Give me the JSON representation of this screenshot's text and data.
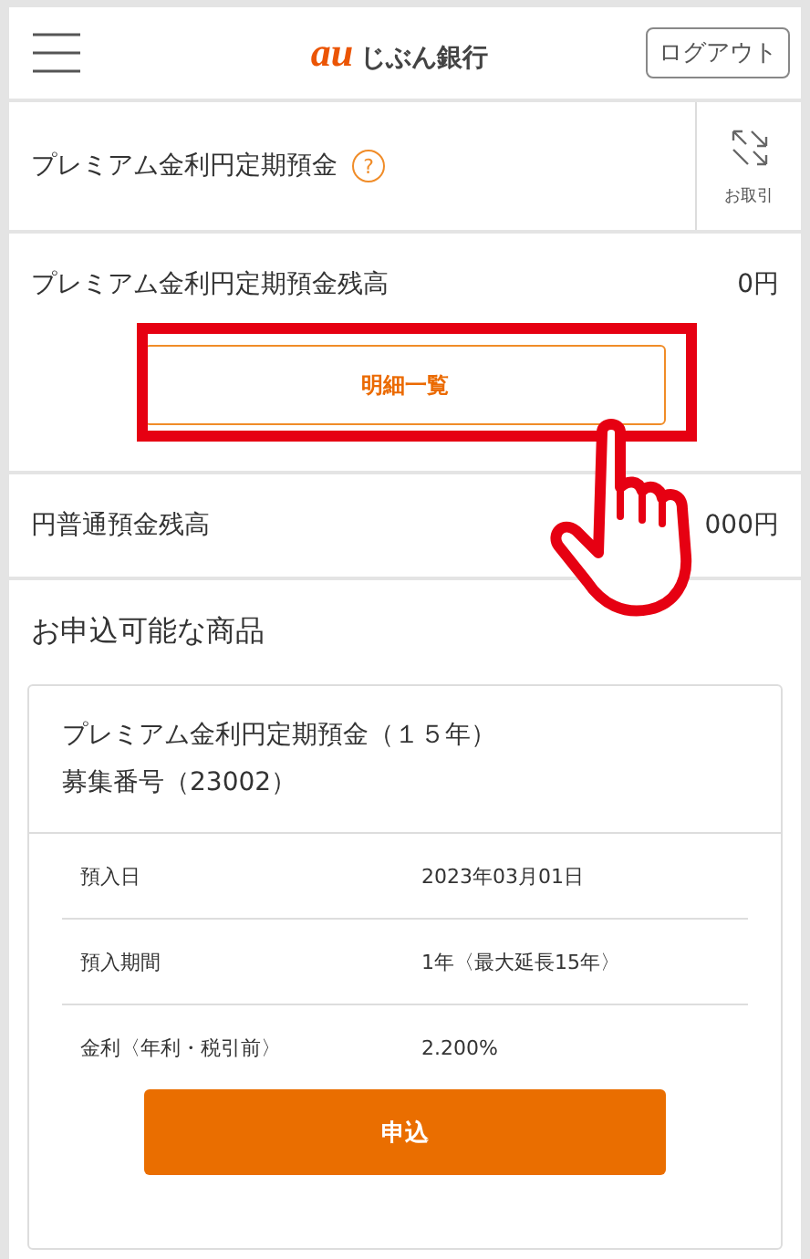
{
  "header": {
    "logo_mark": "au",
    "logo_name": "じぶん銀行",
    "logout": "ログアウト"
  },
  "product_bar": {
    "title": "プレミアム金利円定期預金",
    "help": "?",
    "transactions": "お取引"
  },
  "balances": [
    {
      "label": "プレミアム金利円定期預金残高",
      "value": "0円",
      "button": "明細一覧",
      "highlighted": true
    },
    {
      "label": "円普通預金残高",
      "value": "000円"
    }
  ],
  "offers": {
    "heading": "お申込可能な商品",
    "items": [
      {
        "title": "プレミアム金利円定期預金（１５年）",
        "number": "募集番号（23002）",
        "details": [
          {
            "label": "預入日",
            "value": "2023年03月01日"
          },
          {
            "label": "預入期間",
            "value": "1年〈最大延長15年〉"
          },
          {
            "label": "金利〈年利・税引前〉",
            "value": "2.200%"
          }
        ],
        "apply": "申込"
      }
    ]
  },
  "pointer_hand": true
}
